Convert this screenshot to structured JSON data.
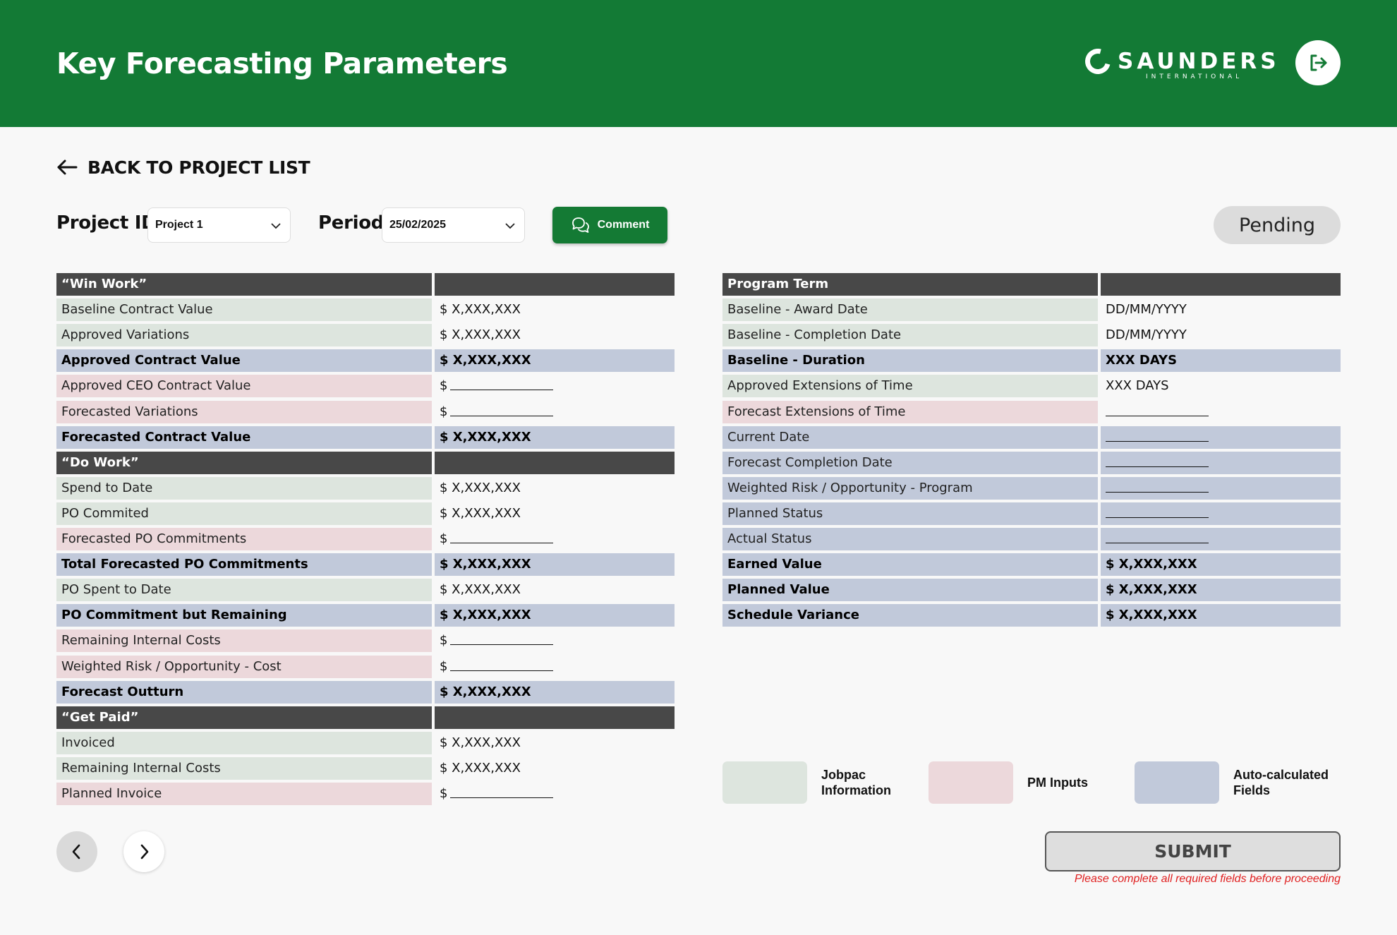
{
  "header": {
    "title": "Key Forecasting Parameters",
    "logo_word": "SAUNDERS",
    "logo_sub": "INTERNATIONAL",
    "brand_color": "#137a35"
  },
  "nav": {
    "back_label": "BACK TO PROJECT LIST"
  },
  "filters": {
    "project_label": "Project ID",
    "project_value": "Project 1",
    "period_label": "Period",
    "period_value": "25/02/2025",
    "comment_label": "Comment"
  },
  "status": "Pending",
  "left_table": [
    {
      "label": "“Win Work”",
      "value": "",
      "type": "section"
    },
    {
      "label": "Baseline Contract Value",
      "value": "$ X,XXX,XXX",
      "type": "jobpac"
    },
    {
      "label": "Approved Variations",
      "value": "$ X,XXX,XXX",
      "type": "jobpac"
    },
    {
      "label": "Approved Contract Value",
      "value": "$ X,XXX,XXX",
      "type": "auto"
    },
    {
      "label": "Approved CEO Contract Value",
      "value": "$",
      "type": "pm"
    },
    {
      "label": "Forecasted Variations",
      "value": "$",
      "type": "pm"
    },
    {
      "label": "Forecasted Contract Value",
      "value": "$ X,XXX,XXX",
      "type": "auto"
    },
    {
      "label": "“Do Work”",
      "value": "",
      "type": "section"
    },
    {
      "label": "Spend to Date",
      "value": "$ X,XXX,XXX",
      "type": "jobpac"
    },
    {
      "label": "PO Commited",
      "value": "$ X,XXX,XXX",
      "type": "jobpac"
    },
    {
      "label": "Forecasted PO Commitments",
      "value": "$",
      "type": "pm"
    },
    {
      "label": "Total Forecasted PO Commitments",
      "value": "$ X,XXX,XXX",
      "type": "auto"
    },
    {
      "label": "PO Spent to Date",
      "value": "$ X,XXX,XXX",
      "type": "jobpac"
    },
    {
      "label": "PO Commitment but Remaining",
      "value": "$ X,XXX,XXX",
      "type": "auto"
    },
    {
      "label": "Remaining Internal Costs",
      "value": "$",
      "type": "pm"
    },
    {
      "label": "Weighted Risk / Opportunity - Cost",
      "value": "$",
      "type": "pm"
    },
    {
      "label": "Forecast Outturn",
      "value": "$ X,XXX,XXX",
      "type": "auto"
    },
    {
      "label": "“Get Paid”",
      "value": "",
      "type": "section"
    },
    {
      "label": "Invoiced",
      "value": "$ X,XXX,XXX",
      "type": "jobpac"
    },
    {
      "label": "Remaining Internal Costs",
      "value": "$ X,XXX,XXX",
      "type": "jobpac"
    },
    {
      "label": "Planned Invoice",
      "value": "$",
      "type": "pm"
    }
  ],
  "right_table": [
    {
      "label": "Program Term",
      "value": "",
      "type": "section"
    },
    {
      "label": "Baseline - Award Date",
      "value": "DD/MM/YYYY",
      "type": "jobpac"
    },
    {
      "label": "Baseline - Completion Date",
      "value": "DD/MM/YYYY",
      "type": "jobpac"
    },
    {
      "label": "Baseline - Duration",
      "value": "XXX DAYS",
      "type": "auto"
    },
    {
      "label": "Approved Extensions of Time",
      "value": "XXX DAYS",
      "type": "jobpac"
    },
    {
      "label": "Forecast Extensions of Time",
      "value": "",
      "type": "pm"
    },
    {
      "label": "Current Date",
      "value": "",
      "type": "autoinput"
    },
    {
      "label": "Forecast Completion Date",
      "value": "",
      "type": "autoinput"
    },
    {
      "label": "Weighted Risk / Opportunity - Program",
      "value": "",
      "type": "autoinput"
    },
    {
      "label": "Planned Status",
      "value": "",
      "type": "autoinput"
    },
    {
      "label": "Actual Status",
      "value": "",
      "type": "autoinput"
    },
    {
      "label": "Earned Value",
      "value": "$ X,XXX,XXX",
      "type": "auto"
    },
    {
      "label": "Planned Value",
      "value": "$ X,XXX,XXX",
      "type": "auto"
    },
    {
      "label": "Schedule Variance",
      "value": "$ X,XXX,XXX",
      "type": "auto"
    }
  ],
  "legend": [
    {
      "label": "Jobpac Information",
      "color": "#dde5de"
    },
    {
      "label": "PM Inputs",
      "color": "#ecd8db"
    },
    {
      "label": "Auto-calculated Fields",
      "color": "#c1c9da"
    }
  ],
  "footer": {
    "submit_label": "SUBMIT",
    "submit_note": "Please complete all required fields before proceeding"
  }
}
